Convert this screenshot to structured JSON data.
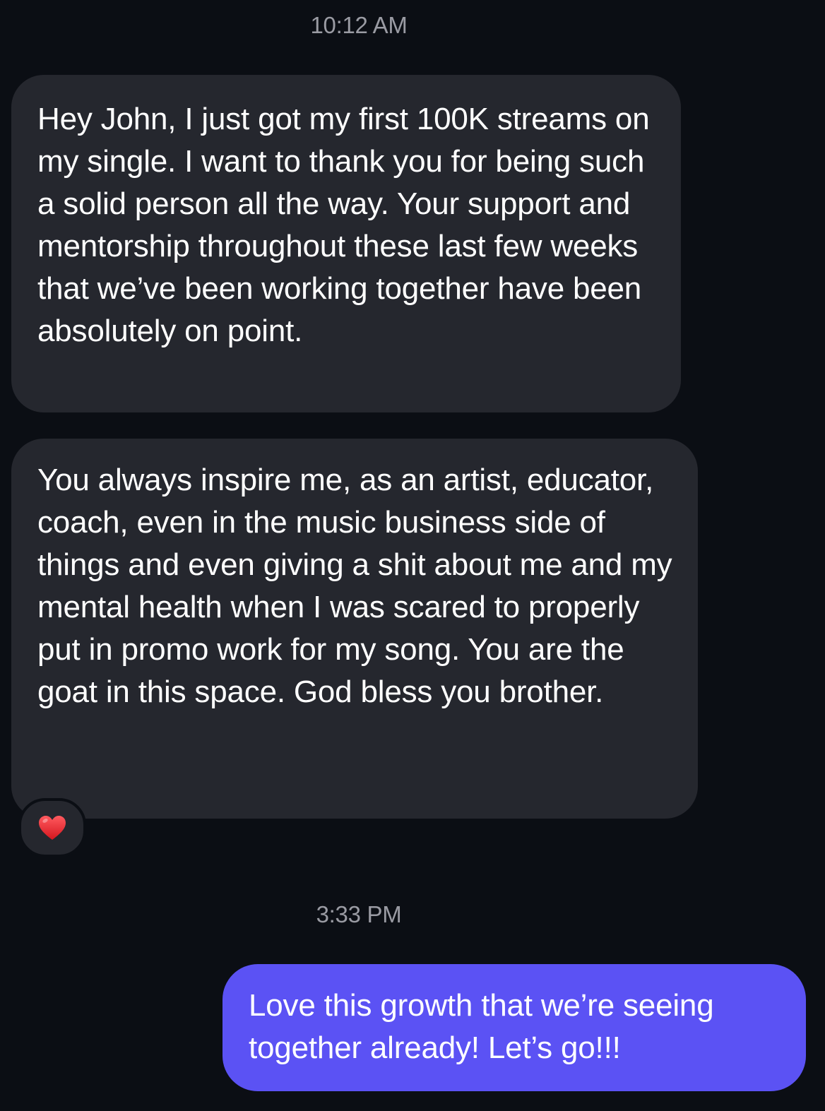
{
  "conversation": {
    "timestamp_1": "10:12 AM",
    "timestamp_2": "3:33 PM",
    "messages": [
      {
        "direction": "incoming",
        "text": "Hey John, I just got my first 100K streams on my single. I want to thank you for being such a solid person all the way. Your support and mentorship throughout these last few weeks that we’ve been working together have been absolutely on point."
      },
      {
        "direction": "incoming",
        "text": "You always inspire me, as an artist, educator, coach, even in the music business side of things and even giving a shit about me and my mental health when I was scared to properly put in promo work for my song. You are the goat in this space. God bless you brother.",
        "reaction": "heart-icon"
      },
      {
        "direction": "outgoing",
        "text": "Love this growth that we’re seeing together already! Let’s go!!!"
      }
    ]
  },
  "colors": {
    "background": "#0b0e14",
    "incoming_bubble": "#25272e",
    "outgoing_bubble": "#5b52f4",
    "timestamp_text": "#9a9ba3",
    "reaction_heart": "#e0242b"
  }
}
